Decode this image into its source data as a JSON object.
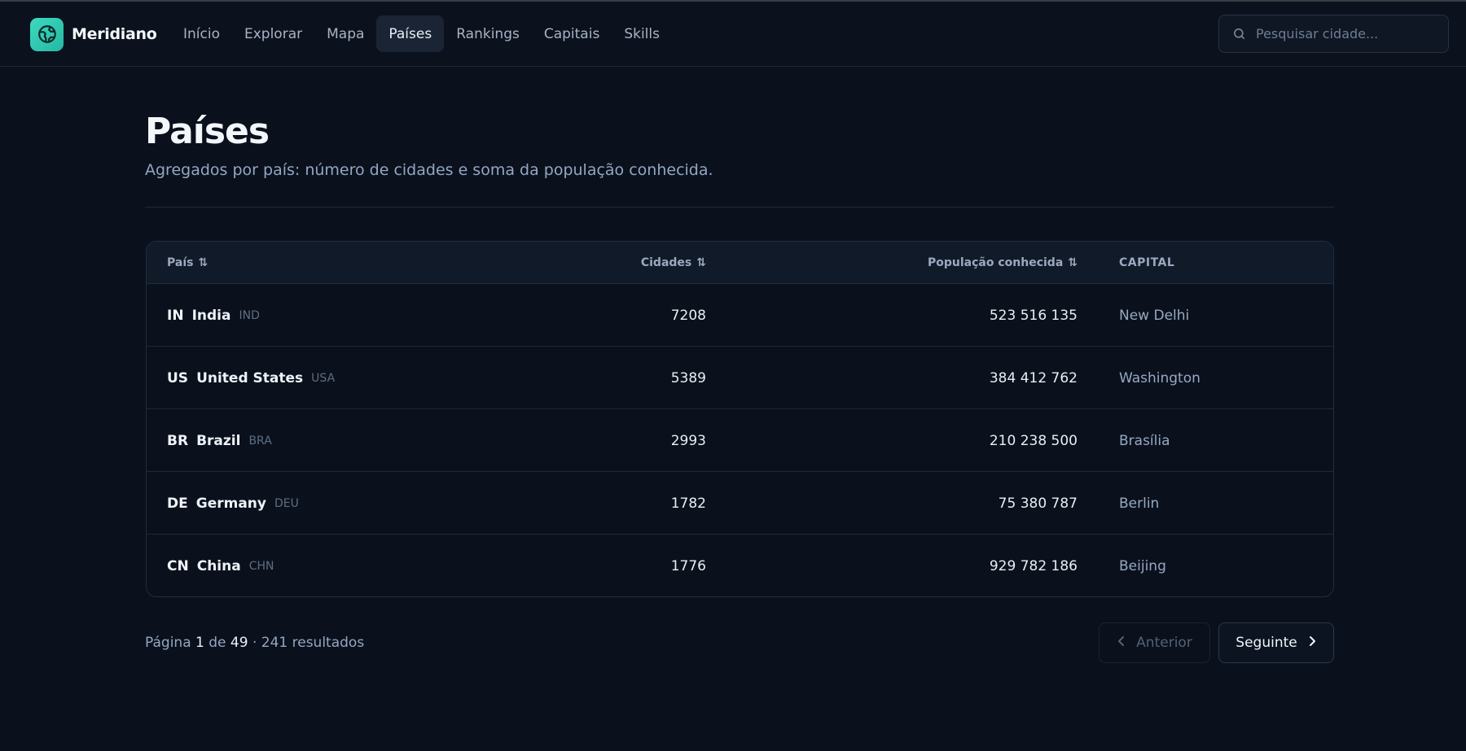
{
  "app": {
    "name": "Meridiano",
    "accent": "#2ec9b0"
  },
  "nav": {
    "items": [
      {
        "label": "Início",
        "active": false
      },
      {
        "label": "Explorar",
        "active": false
      },
      {
        "label": "Mapa",
        "active": false
      },
      {
        "label": "Países",
        "active": true
      },
      {
        "label": "Rankings",
        "active": false
      },
      {
        "label": "Capitais",
        "active": false
      },
      {
        "label": "Skills",
        "active": false
      }
    ]
  },
  "search": {
    "placeholder": "Pesquisar cidade...",
    "value": "",
    "icon": "search-icon"
  },
  "header": {
    "title": "Países",
    "subtitle": "Agregados por país: número de cidades e soma da população conhecida."
  },
  "table": {
    "columns": {
      "country": "País",
      "cities": "Cidades",
      "population": "População conhecida",
      "capital": "CAPITAL"
    },
    "rows": [
      {
        "code2": "IN",
        "name": "India",
        "code3": "IND",
        "cities": "7208",
        "population": "523 516 135",
        "capital": "New Delhi"
      },
      {
        "code2": "US",
        "name": "United States",
        "code3": "USA",
        "cities": "5389",
        "population": "384 412 762",
        "capital": "Washington"
      },
      {
        "code2": "BR",
        "name": "Brazil",
        "code3": "BRA",
        "cities": "2993",
        "population": "210 238 500",
        "capital": "Brasília"
      },
      {
        "code2": "DE",
        "name": "Germany",
        "code3": "DEU",
        "cities": "1782",
        "population": "75 380 787",
        "capital": "Berlin"
      },
      {
        "code2": "CN",
        "name": "China",
        "code3": "CHN",
        "cities": "1776",
        "population": "929 782 186",
        "capital": "Beijing"
      }
    ]
  },
  "pagination": {
    "prefix": "Página",
    "current": "1",
    "of": "de",
    "total": "49",
    "results": "· 241 resultados",
    "prev_label": "Anterior",
    "next_label": "Seguinte",
    "prev_disabled": true
  }
}
